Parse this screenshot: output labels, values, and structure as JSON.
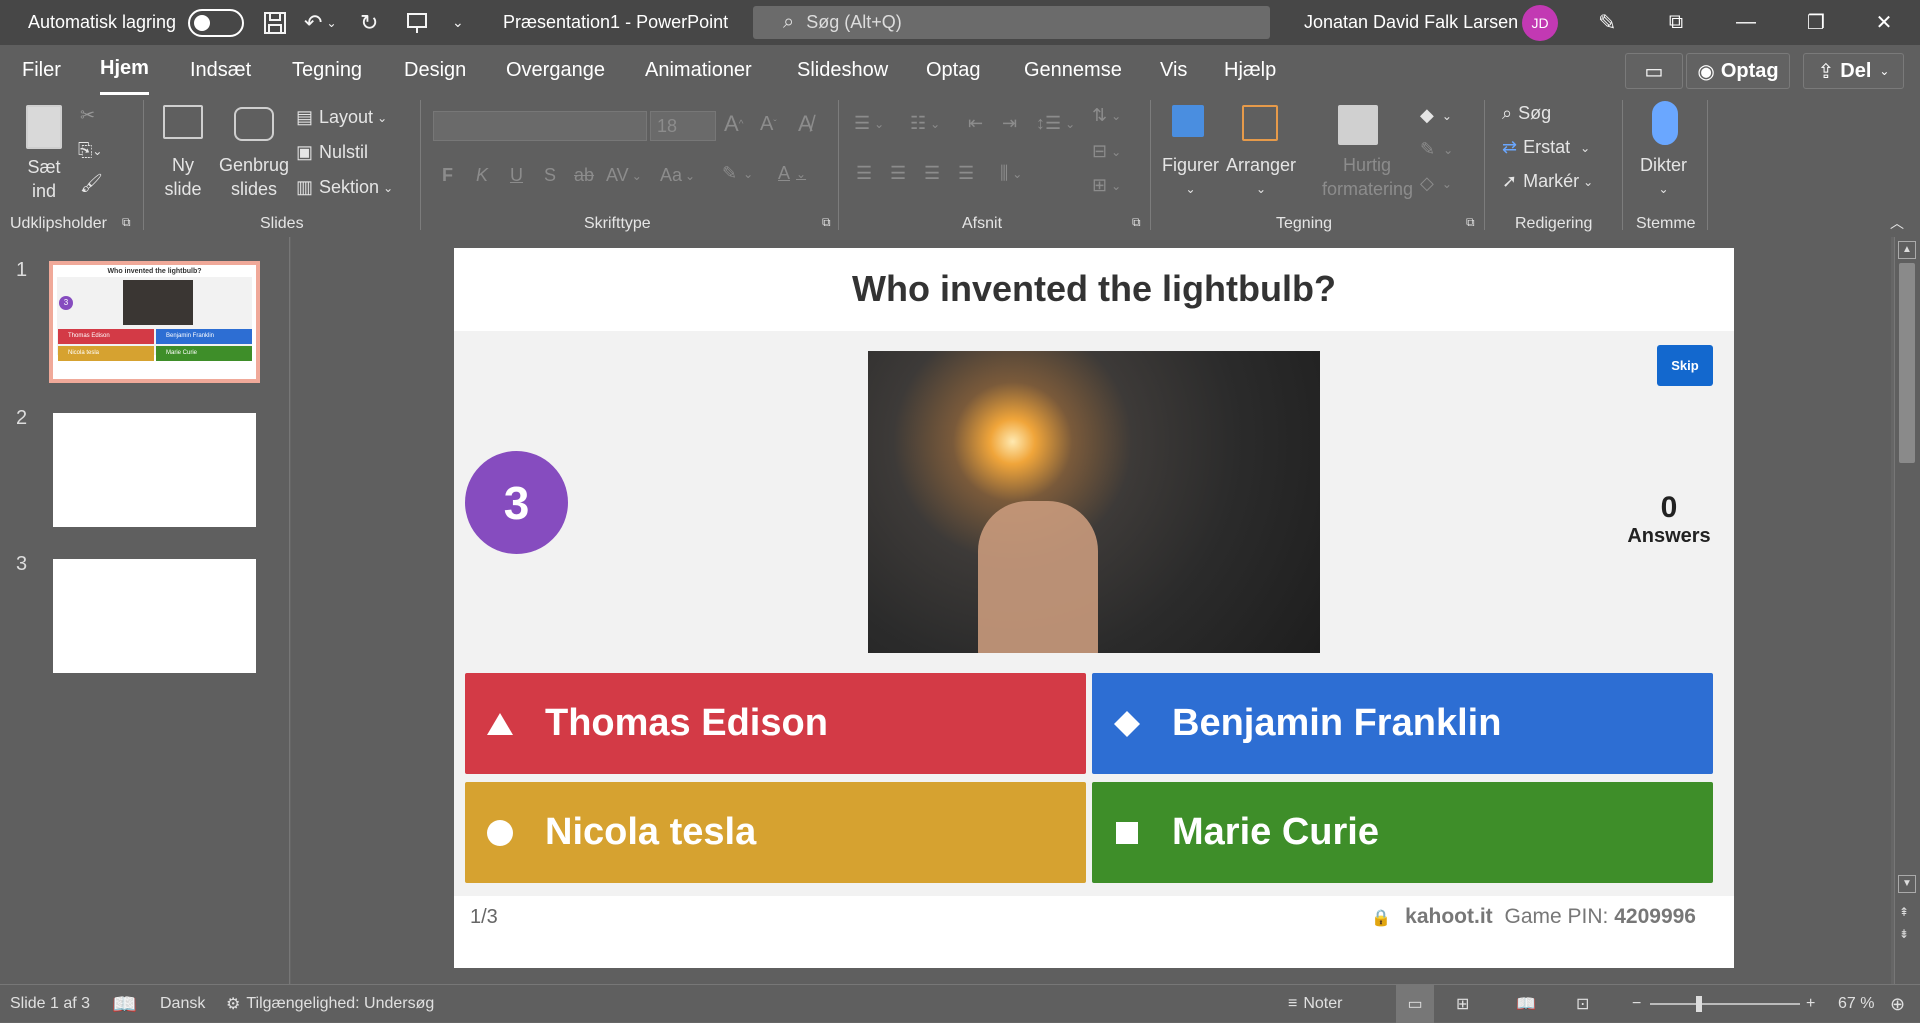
{
  "titlebar": {
    "autosave_label": "Automatisk lagring",
    "doc_title": "Præsentation1  -  PowerPoint",
    "search_placeholder": "Søg (Alt+Q)",
    "user_name": "Jonatan David Falk Larsen",
    "user_initials": "JD"
  },
  "menu": {
    "items": [
      "Filer",
      "Hjem",
      "Indsæt",
      "Tegning",
      "Design",
      "Overgange",
      "Animationer",
      "Slideshow",
      "Optag",
      "Gennemse",
      "Vis",
      "Hjælp"
    ],
    "active": "Hjem",
    "record_label": "Optag",
    "share_label": "Del"
  },
  "ribbon": {
    "clipboard": {
      "paste": "Sæt ind",
      "label": "Udklipsholder"
    },
    "slides": {
      "new_slide": "Ny slide",
      "reuse": "Genbrug slides",
      "layout": "Layout",
      "reset": "Nulstil",
      "section": "Sektion",
      "label": "Slides"
    },
    "font": {
      "size": "18",
      "bold": "F",
      "italic": "K",
      "underline": "U",
      "shadow": "S",
      "strike": "ab",
      "spacing": "AV",
      "case": "Aa",
      "label": "Skrifttype"
    },
    "paragraph": {
      "label": "Afsnit"
    },
    "drawing": {
      "shapes": "Figurer",
      "arrange": "Arranger",
      "quick_styles": "Hurtig formatering",
      "label": "Tegning"
    },
    "editing": {
      "find": "Søg",
      "replace": "Erstat",
      "select": "Markér",
      "label": "Redigering"
    },
    "voice": {
      "dictate": "Dikter",
      "label": "Stemme"
    }
  },
  "thumbnails": {
    "numbers": [
      "1",
      "2",
      "3"
    ],
    "slide1": {
      "title": "Who invented the lightbulb?",
      "timer": "3",
      "answers": [
        "Thomas Edison",
        "Benjamin Franklin",
        "Nicola tesla",
        "Marie Curie"
      ]
    }
  },
  "slide": {
    "question": "Who invented the lightbulb?",
    "timer": "3",
    "skip_label": "Skip",
    "answers_count": "0",
    "answers_label": "Answers",
    "answers": [
      {
        "text": "Thomas Edison",
        "color": "#d33a46",
        "shape": "triangle"
      },
      {
        "text": "Benjamin Franklin",
        "color": "#2d6ed3",
        "shape": "diamond"
      },
      {
        "text": "Nicola tesla",
        "color": "#d6a230",
        "shape": "circle"
      },
      {
        "text": "Marie Curie",
        "color": "#3e8e29",
        "shape": "square"
      }
    ],
    "progress": "1/3",
    "site": "kahoot.it",
    "pin_label": "Game PIN:",
    "pin": "4209996"
  },
  "status": {
    "slide_info": "Slide 1 af 3",
    "language": "Dansk",
    "accessibility": "Tilgængelighed: Undersøg",
    "notes": "Noter",
    "zoom": "67 %"
  }
}
